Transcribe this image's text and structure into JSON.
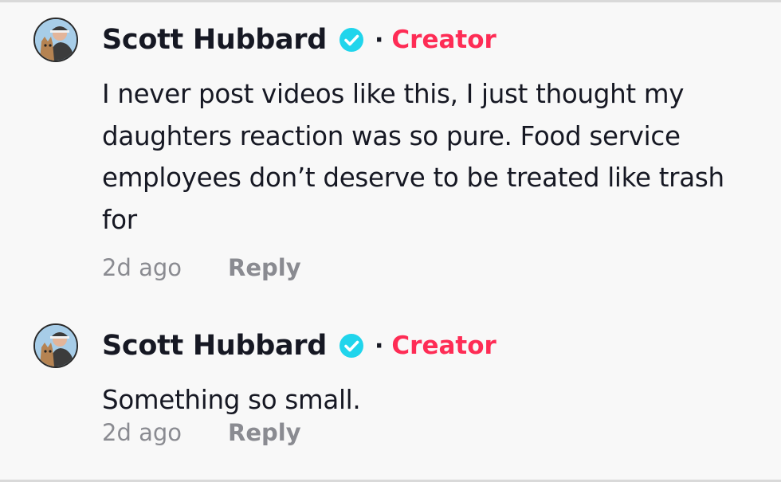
{
  "comments": [
    {
      "author": "Scott Hubbard",
      "separator": "·",
      "badge": "Creator",
      "text": "I never post videos like this, I just thought my daughters reaction was so pure. Food service employees don’t deserve to be treated like trash for",
      "time": "2d ago",
      "reply_label": "Reply"
    },
    {
      "author": "Scott Hubbard",
      "separator": "·",
      "badge": "Creator",
      "text": "Something so small.",
      "time": "2d ago",
      "reply_label": "Reply"
    }
  ],
  "icons": {
    "verified": "verified-checkmark-icon",
    "avatar": "user-avatar-with-dog"
  },
  "colors": {
    "background": "#f8f8f8",
    "text": "#161823",
    "creator_badge": "#fe2c55",
    "verified": "#20d5ec",
    "meta": "#8a8b91"
  }
}
